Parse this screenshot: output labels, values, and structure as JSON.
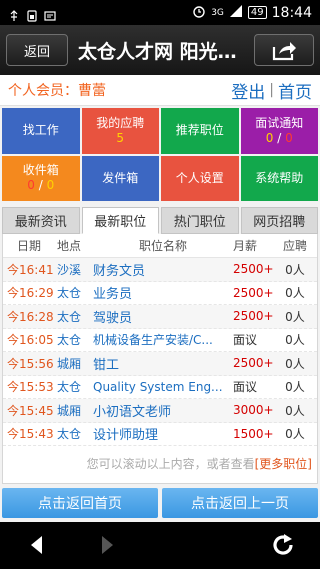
{
  "statusbar": {
    "signal": "3G",
    "battery": "49",
    "time": "18:44"
  },
  "header": {
    "back_label": "返回",
    "title": "太仓人才网 阳光…"
  },
  "member": {
    "label": "个人会员：",
    "name": "曹蕾",
    "logout": "登出",
    "separator": "|",
    "home": "首页"
  },
  "tiles": [
    {
      "label": "找工作",
      "color": "#3c67c2"
    },
    {
      "label": "我的应聘",
      "count": "5",
      "color": "#e8533f"
    },
    {
      "label": "推荐职位",
      "color": "#12a84c"
    },
    {
      "label": "面试通知",
      "count_a": "0",
      "count_sep": " / ",
      "count_b": "0",
      "color": "#9b1ea8"
    },
    {
      "label": "收件箱",
      "count_a": "0",
      "count_sep": " / ",
      "count_b": "0",
      "color": "#f4891e"
    },
    {
      "label": "发件箱",
      "color": "#3c67c2"
    },
    {
      "label": "个人设置",
      "color": "#e8533f"
    },
    {
      "label": "系统帮助",
      "color": "#12a84c"
    }
  ],
  "tabs": [
    "最新资讯",
    "最新职位",
    "热门职位",
    "网页招聘"
  ],
  "table": {
    "headers": {
      "date": "日期",
      "loc": "地点",
      "title": "职位名称",
      "salary": "月薪",
      "num": "应聘"
    },
    "rows": [
      {
        "date": "今16:41",
        "loc": "沙溪",
        "title": "财务文员",
        "salary": "2500+",
        "num": "0人"
      },
      {
        "date": "今16:29",
        "loc": "太仓",
        "title": "业务员",
        "salary": "2500+",
        "num": "0人"
      },
      {
        "date": "今16:28",
        "loc": "太仓",
        "title": "驾驶员",
        "salary": "2500+",
        "num": "0人"
      },
      {
        "date": "今16:05",
        "loc": "太仓",
        "title": "机械设备生产安装/C...",
        "salary": "面议",
        "num": "0人"
      },
      {
        "date": "今15:56",
        "loc": "城厢",
        "title": "钳工",
        "salary": "2500+",
        "num": "0人"
      },
      {
        "date": "今15:53",
        "loc": "太仓",
        "title": "Quality System Eng...",
        "salary": "面议",
        "num": "0人"
      },
      {
        "date": "今15:45",
        "loc": "城厢",
        "title": "小初语文老师",
        "salary": "3000+",
        "num": "0人"
      },
      {
        "date": "今15:43",
        "loc": "太仓",
        "title": "设计师助理",
        "salary": "1500+",
        "num": "0人"
      }
    ]
  },
  "more": {
    "hint": "您可以滚动以上内容，或者查看",
    "link": "[更多职位]"
  },
  "bottom_buttons": {
    "home": "点击返回首页",
    "prev": "点击返回上一页"
  }
}
